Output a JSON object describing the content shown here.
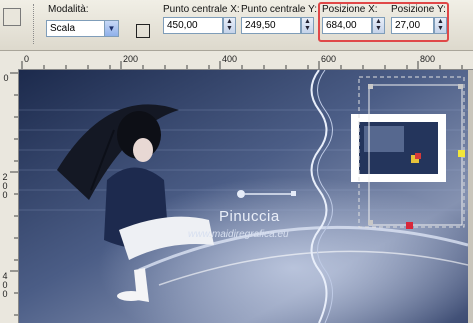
{
  "toolbar": {
    "mode_label": "Modalità:",
    "mode_value": "Scala",
    "center_x_label": "Punto centrale X:",
    "center_x_value": "450,00",
    "center_y_label": "Punto centrale Y:",
    "center_y_value": "249,50",
    "pos_x_label": "Posizione X:",
    "pos_x_value": "684,00",
    "pos_y_label": "Posizione Y:",
    "pos_y_value": "27,00"
  },
  "ruler": {
    "h_ticks": [
      "0",
      "200",
      "400",
      "600",
      "800"
    ],
    "v_ticks": [
      "0",
      "200",
      "400"
    ]
  },
  "canvas": {
    "watermark_name": "Pinuccia",
    "watermark_url": "www.maidiregrafica.eu"
  },
  "colors": {
    "highlight": "#e04848",
    "canvas_bg": "#2a3b63"
  }
}
